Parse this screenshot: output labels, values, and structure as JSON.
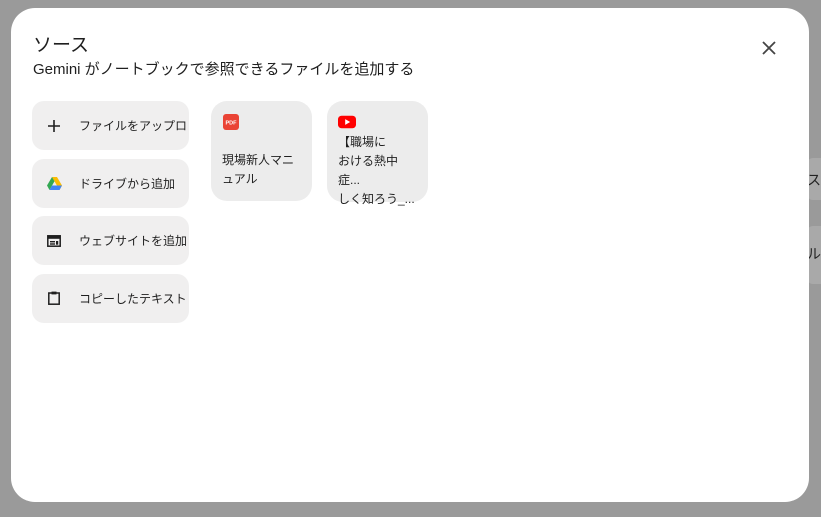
{
  "backdrop": {
    "peek_text_1": "ス",
    "peek_text_2": "ル"
  },
  "dialog": {
    "title": "ソース",
    "subtitle": "Gemini がノートブックで参照できるファイルを追加する",
    "close_icon": "close-icon"
  },
  "actions": [
    {
      "label": "ファイルをアップロ",
      "icon": "plus-icon"
    },
    {
      "label": "ドライブから追加",
      "icon": "google-drive-icon"
    },
    {
      "label": "ウェブサイトを追加",
      "icon": "web-icon"
    },
    {
      "label": "コピーしたテキスト",
      "icon": "clipboard-icon"
    }
  ],
  "sources": [
    {
      "type_label": "PDF",
      "icon": "pdf-icon",
      "title": "現場新人マニュアル",
      "accent": "#ea4335"
    },
    {
      "icon": "youtube-icon",
      "title_lines": [
        "【職場に",
        "おける熱中症...",
        "しく知ろう_..."
      ],
      "accent": "#ff0000"
    }
  ]
}
